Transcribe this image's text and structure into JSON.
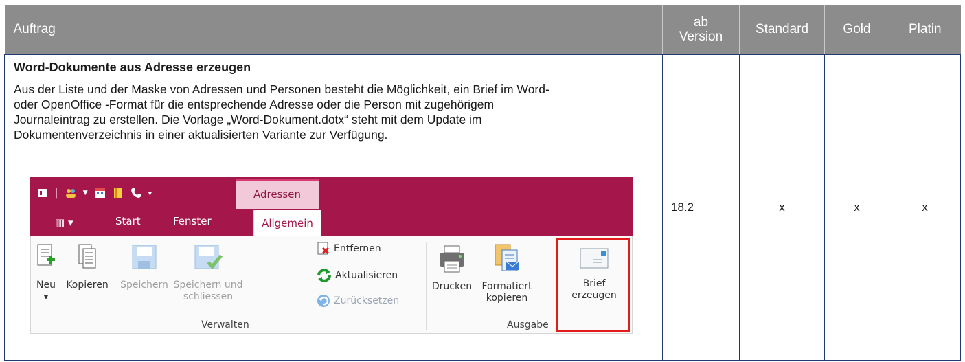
{
  "header": {
    "col_feature": "Auftrag",
    "col_version_1": "ab",
    "col_version_2": "Version",
    "col_standard": "Standard",
    "col_gold": "Gold",
    "col_platin": "Platin"
  },
  "row": {
    "title": "Word-Dokumente aus Adresse erzeugen",
    "description": "Aus der Liste und der Maske von Adressen und Personen besteht die Möglichkeit, ein Brief im Word- oder OpenOffice -Format für die entsprechende Adresse oder die Person mit zugehörigem Journaleintrag zu erstellen. Die Vorlage „Word-Dokument.dotx“ steht mit dem Update im Dokumentenverzeichnis in einer aktualisierten Variante zur Verfügung.",
    "version": "18.2",
    "standard": "x",
    "gold": "x",
    "platin": "x"
  },
  "ribbon": {
    "context_tab": "Adressen",
    "tabs": [
      "Start",
      "Fenster",
      "Allgemein"
    ],
    "buttons": {
      "neu": "Neu",
      "kopieren": "Kopieren",
      "speichern": "Speichern",
      "speichern_schliessen_1": "Speichern und",
      "speichern_schliessen_2": "schliessen",
      "entfernen": "Entfernen",
      "aktualisieren": "Aktualisieren",
      "zuruecksetzen": "Zurücksetzen",
      "drucken": "Drucken",
      "formatiert_1": "Formatiert",
      "formatiert_2": "kopieren",
      "brief_1": "Brief",
      "brief_2": "erzeugen"
    },
    "groups": {
      "verwalten": "Verwalten",
      "ausgabe": "Ausgabe"
    },
    "colors": {
      "ribbon_bg": "#a5174a",
      "highlight": "#e41b1b",
      "header_bg": "#8c8c8c"
    }
  }
}
